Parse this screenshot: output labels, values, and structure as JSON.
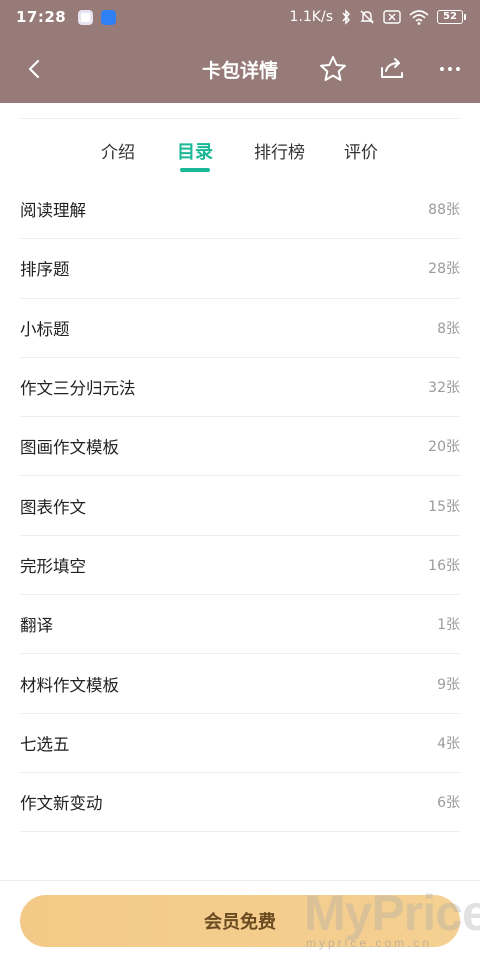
{
  "status_bar": {
    "time": "17:28",
    "network_speed": "1.1K/s",
    "battery": "52"
  },
  "nav": {
    "title": "卡包详情"
  },
  "tabs": [
    {
      "label": "介绍",
      "active": false
    },
    {
      "label": "目录",
      "active": true
    },
    {
      "label": "排行榜",
      "active": false
    },
    {
      "label": "评价",
      "active": false
    }
  ],
  "catalog": [
    {
      "name": "阅读理解",
      "count": "88张"
    },
    {
      "name": "排序题",
      "count": "28张"
    },
    {
      "name": "小标题",
      "count": "8张"
    },
    {
      "name": "作文三分归元法",
      "count": "32张"
    },
    {
      "name": "图画作文模板",
      "count": "20张"
    },
    {
      "name": "图表作文",
      "count": "15张"
    },
    {
      "name": "完形填空",
      "count": "16张"
    },
    {
      "name": "翻译",
      "count": "1张"
    },
    {
      "name": "材料作文模板",
      "count": "9张"
    },
    {
      "name": "七选五",
      "count": "4张"
    },
    {
      "name": "作文新变动",
      "count": "6张"
    }
  ],
  "cta": {
    "label": "会员免费"
  },
  "watermark": {
    "main": "MyPrice",
    "sub": "myprice.com.cn"
  },
  "colors": {
    "header_bg": "#967b78",
    "accent": "#1ab896",
    "cta_bg": "#f3c987",
    "cta_text": "#6a4a20"
  }
}
